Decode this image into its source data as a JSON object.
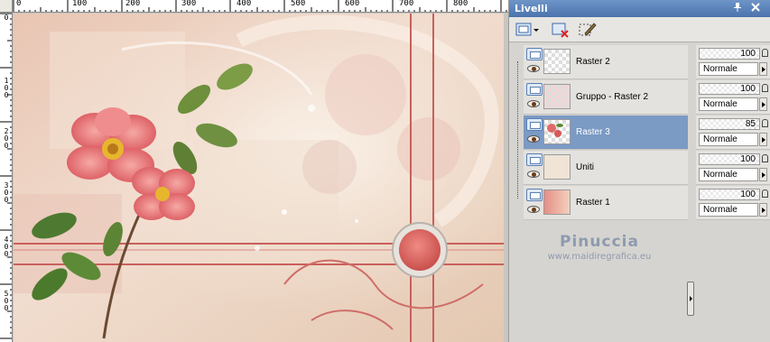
{
  "canvas": {
    "ruler_top_labels": [
      "0",
      "100",
      "200",
      "300",
      "400",
      "500",
      "600",
      "700",
      "800"
    ],
    "ruler_left_labels": [
      "0",
      "100",
      "200",
      "300",
      "400",
      "500"
    ]
  },
  "panel": {
    "title": "Livelli",
    "layers": [
      {
        "name": "Raster 2",
        "opacity": "100",
        "blend": "Normale",
        "selected": false
      },
      {
        "name": "Gruppo - Raster 2",
        "opacity": "100",
        "blend": "Normale",
        "selected": false
      },
      {
        "name": "Raster 3",
        "opacity": "85",
        "blend": "Normale",
        "selected": true
      },
      {
        "name": "Uniti",
        "opacity": "100",
        "blend": "Normale",
        "selected": false
      },
      {
        "name": "Raster 1",
        "opacity": "100",
        "blend": "Normale",
        "selected": false
      }
    ]
  },
  "watermark": {
    "name": "Pinuccia",
    "url": "www.maidiregrafica.eu"
  },
  "icons": {
    "pin": "pin-icon",
    "close": "close-icon",
    "new_layer": "new-layer-icon",
    "delete_layer": "delete-layer-icon",
    "edit_layer": "edit-layer-icon"
  }
}
